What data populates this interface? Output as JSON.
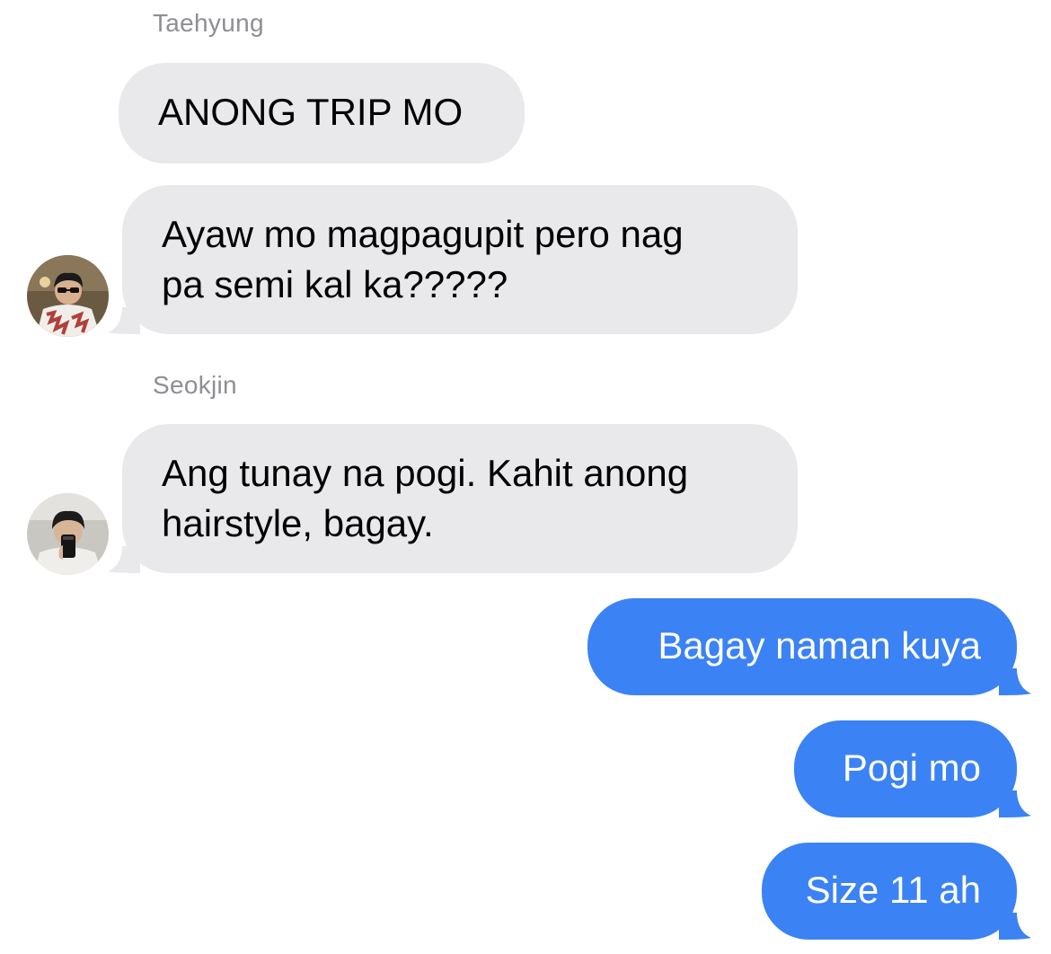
{
  "conversation": {
    "senders": {
      "taehyung": "Taehyung",
      "seokjin": "Seokjin"
    },
    "messages": [
      {
        "from": "Taehyung",
        "text": "ANONG TRIP MO"
      },
      {
        "from": "Taehyung",
        "lines": [
          "Ayaw mo magpagupit pero nag",
          "pa semi kal ka?????"
        ]
      },
      {
        "from": "Seokjin",
        "lines": [
          "Ang tunay na pogi. Kahit anong",
          "hairstyle, bagay."
        ]
      },
      {
        "from": "me",
        "text": "Bagay naman kuya"
      },
      {
        "from": "me",
        "text": "Pogi mo"
      },
      {
        "from": "me",
        "text": "Size 11 ah"
      }
    ]
  },
  "colors": {
    "incoming_bubble": "#e9e9eb",
    "outgoing_bubble": "#3b82f4",
    "sender_name": "#8e8e93"
  },
  "icons": {
    "taehyung_avatar": "avatar-photo-icon",
    "seokjin_avatar": "avatar-photo-icon"
  }
}
